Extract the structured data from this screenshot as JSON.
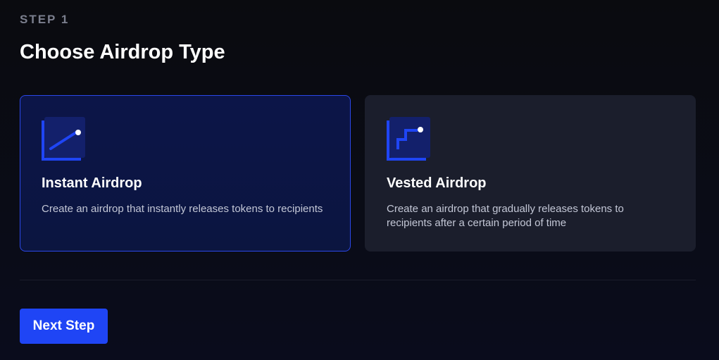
{
  "header": {
    "step_label": "STEP 1",
    "title": "Choose Airdrop Type"
  },
  "options": [
    {
      "title": "Instant Airdrop",
      "description": "Create an airdrop that instantly releases tokens to recipients",
      "icon": "linear-chart-icon",
      "selected": true
    },
    {
      "title": "Vested Airdrop",
      "description": "Create an airdrop that gradually releases tokens to recipients after a certain period of time",
      "icon": "step-chart-icon",
      "selected": false
    }
  ],
  "footer": {
    "next_label": "Next Step"
  },
  "colors": {
    "accent": "#1f45f5",
    "selected_border": "#2b47e8",
    "card_bg": "#1b1e2c",
    "selected_bg": "#0c1548",
    "muted_text": "#7b7f8e"
  }
}
